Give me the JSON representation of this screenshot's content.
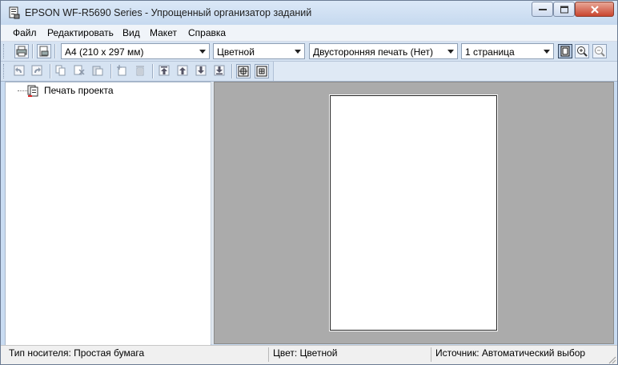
{
  "window": {
    "title": "EPSON WF-R5690 Series - Упрощенный организатор заданий"
  },
  "menu": {
    "items": [
      "Файл",
      "Редактировать",
      "Вид",
      "Макет",
      "Справка"
    ]
  },
  "toolbar": {
    "paper_size": "A4 (210 x 297 мм)",
    "color_mode": "Цветной",
    "duplex": "Двусторонняя печать (Нет)",
    "pages_per_sheet": "1 страница"
  },
  "tree": {
    "root_label": "Печать проекта"
  },
  "status": {
    "media_type": "Тип носителя: Простая бумага",
    "color": "Цвет: Цветной",
    "source": "Источник: Автоматический выбор"
  },
  "icons": {
    "app": "printer-document-icon",
    "print": "print-icon",
    "print_preview": "print-preview-icon",
    "undo": "undo-icon",
    "redo": "redo-icon",
    "copy": "copy-icon",
    "cut": "cut-icon",
    "paste": "paste-icon",
    "new_page": "new-page-icon",
    "delete": "delete-icon",
    "move_top": "move-to-top-icon",
    "move_up": "move-up-icon",
    "move_down": "move-down-icon",
    "move_bottom": "move-to-bottom-icon",
    "group": "group-icon",
    "ungroup": "ungroup-icon",
    "fit_page": "fit-page-icon",
    "zoom_in": "zoom-in-icon",
    "zoom_out": "zoom-out-icon"
  },
  "colors": {
    "frame": "#c9dcf2",
    "preview_background": "#ababab",
    "close_button": "#c9452f"
  }
}
